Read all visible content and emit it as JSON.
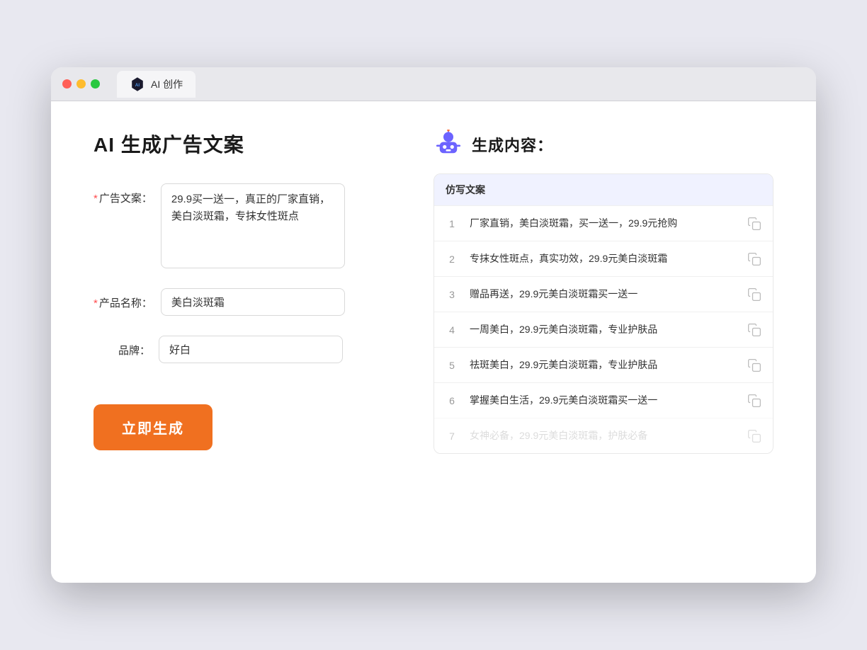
{
  "browser": {
    "tab_label": "AI 创作"
  },
  "page": {
    "title": "AI 生成广告文案",
    "result_title": "生成内容："
  },
  "form": {
    "ad_copy_label": "广告文案：",
    "ad_copy_required": "*",
    "ad_copy_value": "29.9买一送一，真正的厂家直销，美白淡斑霜，专抹女性斑点",
    "product_name_label": "产品名称：",
    "product_name_required": "*",
    "product_name_value": "美白淡斑霜",
    "brand_label": "品牌：",
    "brand_value": "好白",
    "generate_btn": "立即生成"
  },
  "results": {
    "table_header": "仿写文案",
    "items": [
      {
        "num": "1",
        "text": "厂家直销，美白淡斑霜，买一送一，29.9元抢购"
      },
      {
        "num": "2",
        "text": "专抹女性斑点，真实功效，29.9元美白淡斑霜"
      },
      {
        "num": "3",
        "text": "赠品再送，29.9元美白淡斑霜买一送一"
      },
      {
        "num": "4",
        "text": "一周美白，29.9元美白淡斑霜，专业护肤品"
      },
      {
        "num": "5",
        "text": "祛斑美白，29.9元美白淡斑霜，专业护肤品"
      },
      {
        "num": "6",
        "text": "掌握美白生活，29.9元美白淡斑霜买一送一"
      },
      {
        "num": "7",
        "text": "女神必备，29.9元美白淡斑霜，护肤必备"
      }
    ]
  }
}
